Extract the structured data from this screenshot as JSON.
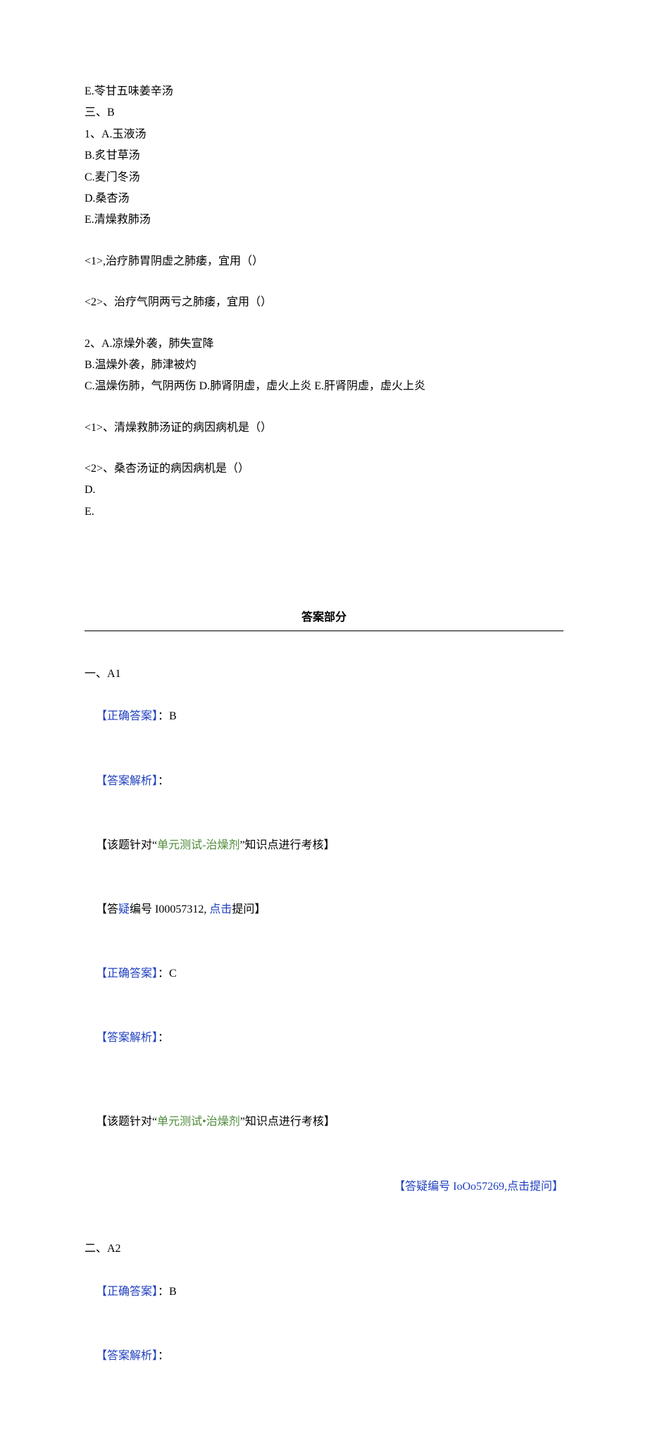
{
  "questions": {
    "optE_top": "E.苓甘五味姜辛汤",
    "sectionThree": "三、B",
    "q1": {
      "header": "1、A.玉液汤",
      "optB": "B.炙甘草汤",
      "optC": "C.麦门冬汤",
      "optD": "D.桑杏汤",
      "optE": "E.清燥救肺汤",
      "sub1": "<1>,治疗肺胃阴虚之肺痿，宜用（）",
      "sub2": "<2>、治疗气阴两亏之肺痿，宜用（）"
    },
    "q2": {
      "header": "2、A.凉燥外袭，肺失宣降",
      "optB": "B.温燥外袭，肺津被灼",
      "optC": "C.温燥伤肺，气阴两伤 D.肺肾阴虚，虚火上炎 E.肝肾阴虚，虚火上炎",
      "sub1": "<1>、清燥救肺汤证的病因病机是（）",
      "sub2": "<2>、桑杏汤证的病因病机是（）",
      "lineD": "D.",
      "lineE": "E."
    }
  },
  "answersHeading": "答案部分",
  "answers": {
    "a1": {
      "section": "一、A1",
      "ca_label": "【正确答案】",
      "ca_sep": "：",
      "ca_val": "B",
      "exp_label": "【答案解析】",
      "exp_sep": "：",
      "kp_pre": "【该题针对“",
      "kp_green": "单元测试-治燥剂",
      "kp_post": "”知识点进行考核】",
      "faq_pre": "【答",
      "faq_mid1": "疑",
      "faq_mid2": "编号 I00057312, ",
      "faq_link": "点击",
      "faq_post": "提问】",
      "ca2_val": "C",
      "kp2_pre": "【该题针对“",
      "kp2_green": "单元测试•治燥剂",
      "kp2_post": "”知识点进行考核】",
      "faq2_full": "【答疑编号 IoOo57269,点击提问】"
    },
    "a2": {
      "section": "二、A2",
      "ca_val": "B"
    }
  }
}
